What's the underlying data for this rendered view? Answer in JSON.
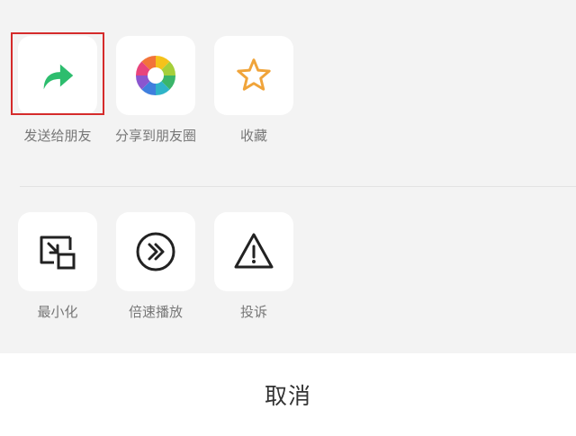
{
  "row1": [
    {
      "label": "发送给朋友",
      "icon": "share-arrow-icon"
    },
    {
      "label": "分享到朋友圈",
      "icon": "moments-aperture-icon"
    },
    {
      "label": "收藏",
      "icon": "star-icon"
    }
  ],
  "row2": [
    {
      "label": "最小化",
      "icon": "minimize-window-icon"
    },
    {
      "label": "倍速播放",
      "icon": "speed-play-icon"
    },
    {
      "label": "投诉",
      "icon": "warning-triangle-icon"
    }
  ],
  "cancel_label": "取消",
  "colors": {
    "share_green": "#2dbd6e",
    "star_orange": "#f0a43a",
    "highlight_red": "#d52b2b"
  }
}
